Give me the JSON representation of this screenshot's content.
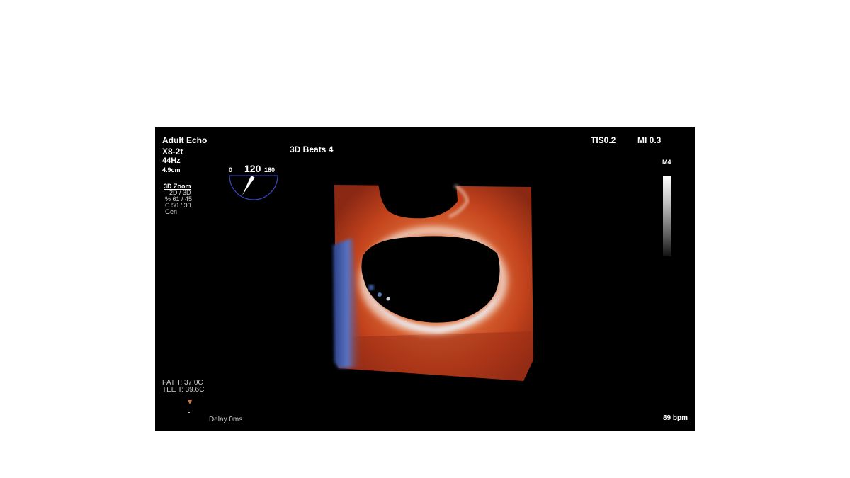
{
  "header": {
    "preset": "Adult Echo",
    "probe": "X8-2t",
    "frame_rate": "44Hz",
    "depth": "4.9cm",
    "beats": "3D Beats 4",
    "tis": "TIS0.2",
    "mi": "MI 0.3"
  },
  "mode": {
    "title": "3D Zoom",
    "lines": [
      "2D / 3D",
      "% 61 / 45",
      "C  50 / 30",
      "Gen"
    ]
  },
  "angle_indicator": {
    "min_label": "0",
    "value": "120",
    "max_label": "180",
    "angle_value": 120
  },
  "grayscale_map": {
    "label": "M4"
  },
  "temps": {
    "patient": "PAT T: 37.0C",
    "tee": "TEE T: 39.6C"
  },
  "footer": {
    "delay": "Delay 0ms",
    "heart_rate": "89 bpm"
  },
  "colors": {
    "screen_bg": "#000000",
    "tissue_red": "#c3431c",
    "tissue_blue": "#3c5aa8",
    "angle_arc": "#3a48c8",
    "ecg_marker": "#c8783c"
  }
}
